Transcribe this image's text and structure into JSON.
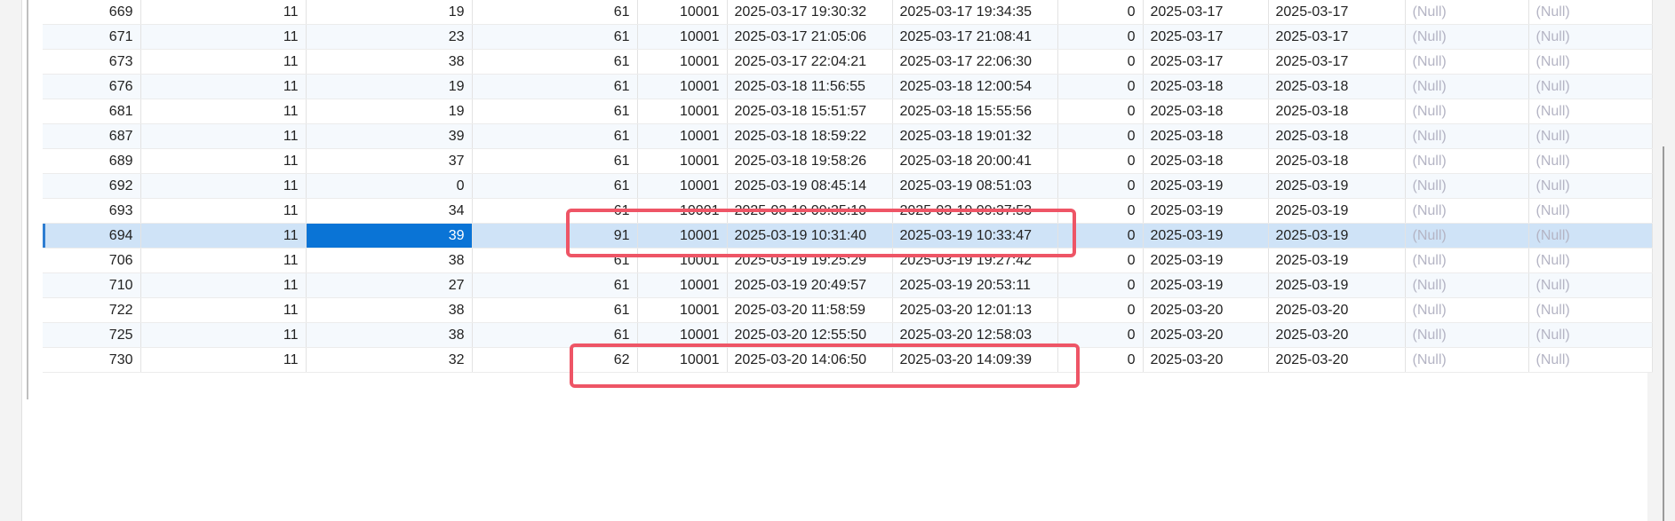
{
  "grid": {
    "rows": [
      {
        "id": "669",
        "c2": "11",
        "c3": "19",
        "c4": "61",
        "c5": "10001",
        "start": "2025-03-17 19:30:32",
        "end": "2025-03-17 19:34:35",
        "flag": "0",
        "d1": "2025-03-17",
        "d2": "2025-03-17",
        "n1": "(Null)",
        "n2": "(Null)"
      },
      {
        "id": "671",
        "c2": "11",
        "c3": "23",
        "c4": "61",
        "c5": "10001",
        "start": "2025-03-17 21:05:06",
        "end": "2025-03-17 21:08:41",
        "flag": "0",
        "d1": "2025-03-17",
        "d2": "2025-03-17",
        "n1": "(Null)",
        "n2": "(Null)"
      },
      {
        "id": "673",
        "c2": "11",
        "c3": "38",
        "c4": "61",
        "c5": "10001",
        "start": "2025-03-17 22:04:21",
        "end": "2025-03-17 22:06:30",
        "flag": "0",
        "d1": "2025-03-17",
        "d2": "2025-03-17",
        "n1": "(Null)",
        "n2": "(Null)"
      },
      {
        "id": "676",
        "c2": "11",
        "c3": "19",
        "c4": "61",
        "c5": "10001",
        "start": "2025-03-18 11:56:55",
        "end": "2025-03-18 12:00:54",
        "flag": "0",
        "d1": "2025-03-18",
        "d2": "2025-03-18",
        "n1": "(Null)",
        "n2": "(Null)"
      },
      {
        "id": "681",
        "c2": "11",
        "c3": "19",
        "c4": "61",
        "c5": "10001",
        "start": "2025-03-18 15:51:57",
        "end": "2025-03-18 15:55:56",
        "flag": "0",
        "d1": "2025-03-18",
        "d2": "2025-03-18",
        "n1": "(Null)",
        "n2": "(Null)"
      },
      {
        "id": "687",
        "c2": "11",
        "c3": "39",
        "c4": "61",
        "c5": "10001",
        "start": "2025-03-18 18:59:22",
        "end": "2025-03-18 19:01:32",
        "flag": "0",
        "d1": "2025-03-18",
        "d2": "2025-03-18",
        "n1": "(Null)",
        "n2": "(Null)"
      },
      {
        "id": "689",
        "c2": "11",
        "c3": "37",
        "c4": "61",
        "c5": "10001",
        "start": "2025-03-18 19:58:26",
        "end": "2025-03-18 20:00:41",
        "flag": "0",
        "d1": "2025-03-18",
        "d2": "2025-03-18",
        "n1": "(Null)",
        "n2": "(Null)"
      },
      {
        "id": "692",
        "c2": "11",
        "c3": "0",
        "c4": "61",
        "c5": "10001",
        "start": "2025-03-19 08:45:14",
        "end": "2025-03-19 08:51:03",
        "flag": "0",
        "d1": "2025-03-19",
        "d2": "2025-03-19",
        "n1": "(Null)",
        "n2": "(Null)"
      },
      {
        "id": "693",
        "c2": "11",
        "c3": "34",
        "c4": "61",
        "c5": "10001",
        "start": "2025-03-19 09:35:10",
        "end": "2025-03-19 09:37:53",
        "flag": "0",
        "d1": "2025-03-19",
        "d2": "2025-03-19",
        "n1": "(Null)",
        "n2": "(Null)"
      },
      {
        "id": "694",
        "c2": "11",
        "c3": "39",
        "c4": "91",
        "c5": "10001",
        "start": "2025-03-19 10:31:40",
        "end": "2025-03-19 10:33:47",
        "flag": "0",
        "d1": "2025-03-19",
        "d2": "2025-03-19",
        "n1": "(Null)",
        "n2": "(Null)"
      },
      {
        "id": "706",
        "c2": "11",
        "c3": "38",
        "c4": "61",
        "c5": "10001",
        "start": "2025-03-19 19:25:29",
        "end": "2025-03-19 19:27:42",
        "flag": "0",
        "d1": "2025-03-19",
        "d2": "2025-03-19",
        "n1": "(Null)",
        "n2": "(Null)"
      },
      {
        "id": "710",
        "c2": "11",
        "c3": "27",
        "c4": "61",
        "c5": "10001",
        "start": "2025-03-19 20:49:57",
        "end": "2025-03-19 20:53:11",
        "flag": "0",
        "d1": "2025-03-19",
        "d2": "2025-03-19",
        "n1": "(Null)",
        "n2": "(Null)"
      },
      {
        "id": "722",
        "c2": "11",
        "c3": "38",
        "c4": "61",
        "c5": "10001",
        "start": "2025-03-20 11:58:59",
        "end": "2025-03-20 12:01:13",
        "flag": "0",
        "d1": "2025-03-20",
        "d2": "2025-03-20",
        "n1": "(Null)",
        "n2": "(Null)"
      },
      {
        "id": "725",
        "c2": "11",
        "c3": "38",
        "c4": "61",
        "c5": "10001",
        "start": "2025-03-20 12:55:50",
        "end": "2025-03-20 12:58:03",
        "flag": "0",
        "d1": "2025-03-20",
        "d2": "2025-03-20",
        "n1": "(Null)",
        "n2": "(Null)"
      },
      {
        "id": "730",
        "c2": "11",
        "c3": "32",
        "c4": "62",
        "c5": "10001",
        "start": "2025-03-20 14:06:50",
        "end": "2025-03-20 14:09:39",
        "flag": "0",
        "d1": "2025-03-20",
        "d2": "2025-03-20",
        "n1": "(Null)",
        "n2": "(Null)"
      }
    ]
  },
  "colors": {
    "selection_row": "#cfe3f7",
    "active_cell": "#0a74d6",
    "highlight_border": "#ee5566",
    "null_text": "#b4b4c4"
  }
}
